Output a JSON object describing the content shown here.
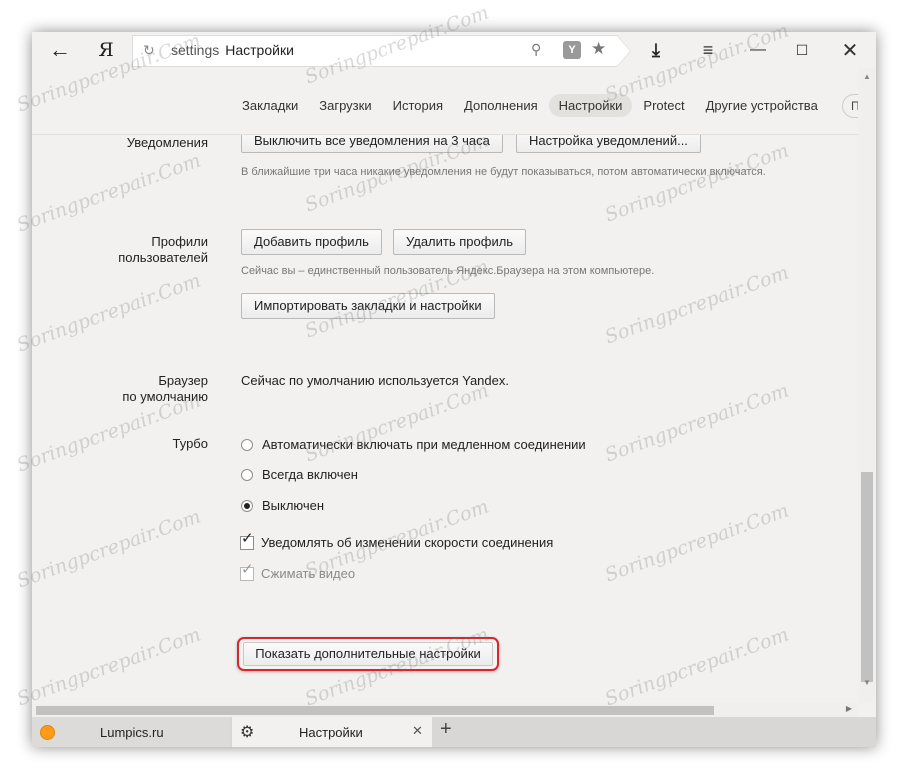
{
  "toolbar": {
    "back_icon": "arrow-left-icon",
    "logo": "Я",
    "url_prefix": "settings",
    "url_title": "Настройки"
  },
  "nav": {
    "tabs": [
      "Закладки",
      "Загрузки",
      "История",
      "Дополнения",
      "Настройки",
      "Protect",
      "Другие устройства"
    ],
    "active_tab": "Настройки",
    "more_label": "П"
  },
  "notifications": {
    "label": "Уведомления",
    "disable_button": "Выключить все уведомления на 3 часа",
    "settings_button": "Настройка уведомлений...",
    "hint": "В ближайшие три часа никакие уведомления не будут показываться, потом автоматически включатся."
  },
  "profiles": {
    "label_line1": "Профили",
    "label_line2": "пользователей",
    "add_button": "Добавить профиль",
    "delete_button": "Удалить профиль",
    "hint": "Сейчас вы – единственный пользователь Яндекс.Браузера на этом компьютере.",
    "import_button": "Импортировать закладки и настройки"
  },
  "default_browser": {
    "label_line1": "Браузер",
    "label_line2": "по умолчанию",
    "text": "Сейчас по умолчанию используется Yandex."
  },
  "turbo": {
    "label": "Турбо",
    "options": [
      {
        "label": "Автоматически включать при медленном соединении",
        "selected": false
      },
      {
        "label": "Всегда включен",
        "selected": false
      },
      {
        "label": "Выключен",
        "selected": true
      }
    ],
    "checkboxes": [
      {
        "label": "Уведомлять об изменении скорости соединения",
        "checked": true,
        "disabled": false
      },
      {
        "label": "Сжимать видео",
        "checked": true,
        "disabled": true
      }
    ]
  },
  "show_more_button": "Показать дополнительные настройки",
  "tabs": [
    {
      "title": "Lumpics.ru",
      "icon": "orange-favicon-icon",
      "active": false
    },
    {
      "title": "Настройки",
      "icon": "gear-icon",
      "active": true
    }
  ],
  "watermark": "Soringpcrepair.Com",
  "colors": {
    "highlight": "#d9252b",
    "background": "#f2f1ef"
  }
}
